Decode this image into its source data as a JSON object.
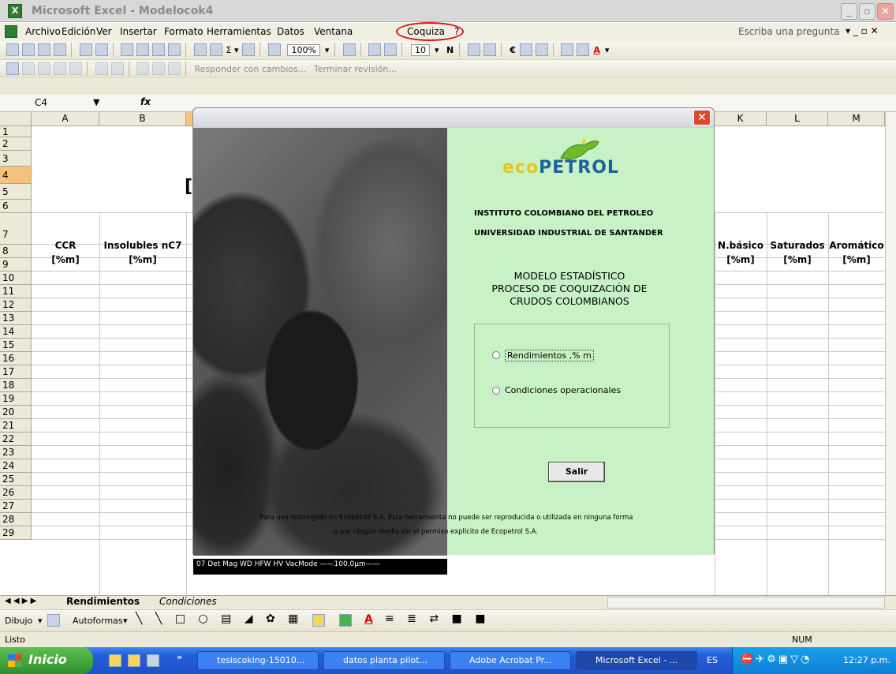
{
  "window": {
    "title": "Microsoft Excel - Modelocok4"
  },
  "menu": {
    "items": [
      "Archivo",
      "Edición",
      "Ver",
      "Insertar",
      "Formato",
      "Herramientas",
      "Datos",
      "Ventana",
      "Coquiza",
      "?"
    ],
    "ask_placeholder": "Escriba una pregunta"
  },
  "toolbar": {
    "zoom": "100%",
    "font_size": "10",
    "bold": "N",
    "currency": "€"
  },
  "review_toolbar": {
    "reply": "Responder con cambios...",
    "end": "Terminar revisión..."
  },
  "formula_bar": {
    "cell_ref": "C4",
    "fx": "fx"
  },
  "grid": {
    "columns": [
      "A",
      "B",
      "K",
      "L",
      "M"
    ],
    "rows": [
      "1",
      "2",
      "3",
      "4",
      "5",
      "6",
      "7",
      "8",
      "9",
      "10",
      "11",
      "12",
      "13",
      "14",
      "15",
      "16",
      "17",
      "18",
      "19",
      "20",
      "21",
      "22",
      "23",
      "24",
      "25",
      "26",
      "27",
      "28",
      "29"
    ],
    "headers_left": [
      {
        "title": "CCR",
        "unit": "[%m]"
      },
      {
        "title": "Insolubles nC7",
        "unit": "[%m]"
      }
    ],
    "headers_right": [
      {
        "title": "N.básico",
        "unit": "[%m]"
      },
      {
        "title": "Saturados",
        "unit": "[%m]"
      },
      {
        "title": "Aromático",
        "unit": "[%m]"
      }
    ],
    "cell_fragment": "["
  },
  "dialog": {
    "brand": "ECOPETROL",
    "org1": "INSTITUTO COLOMBIANO DEL PETROLEO",
    "org2": "UNIVERSIDAD INDUSTRIAL DE SANTANDER",
    "model_l1": "MODELO ESTADÍSTICO",
    "model_l2": "PROCESO DE COQUIZACIÓN DE",
    "model_l3": "CRUDOS COLOMBIANOS",
    "option1": "Rendimientos ,% m",
    "option2": "Condiciones operacionales",
    "salir": "Salir",
    "footer1": "Para uso restringido en Ecopetrol S.A. Esta herramienta no puede ser reproducida o utilizada en ninguna forma",
    "footer2": "o por ningún medio sin el permiso explícito de Ecopetrol S.A.",
    "sem_text": "07  Det  Mag   WD    HFW    HV   VacMode  ——100.0μm——"
  },
  "sheet_tabs": {
    "active": "Rendimientos",
    "other": "Condiciones"
  },
  "draw_toolbar": {
    "dibujo": "Dibujo",
    "autoformas": "Autoformas"
  },
  "status": {
    "left": "Listo",
    "num": "NUM"
  },
  "taskbar": {
    "start": "Inicio",
    "tasks": [
      "tesiscoking-15010...",
      "datos planta pilot...",
      "Adobe Acrobat Pr...",
      "Microsoft Excel - ..."
    ],
    "lang": "ES",
    "clock": "12:27 p.m."
  },
  "colors": {
    "panel_green": "#c8f2c5",
    "taskbar_blue": "#245edb",
    "accent_red": "#e01010"
  }
}
